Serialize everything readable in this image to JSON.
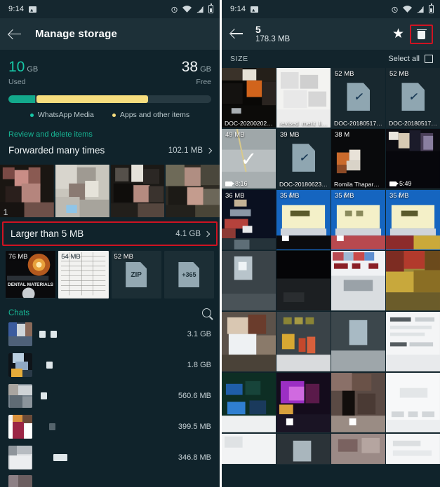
{
  "left": {
    "statusbar": {
      "time": "9:14",
      "icons": [
        "photo-icon",
        "alarm-icon",
        "wifi-icon",
        "signal-icon",
        "battery-icon"
      ]
    },
    "appbar": {
      "back": "back-arrow",
      "title": "Manage storage"
    },
    "storage": {
      "used_value": "10",
      "used_unit": "GB",
      "used_label": "Used",
      "free_value": "38",
      "free_unit": "GB",
      "free_label": "Free",
      "bar": {
        "media_pct": 13,
        "apps_pct": 55,
        "media_color": "#13a98c",
        "apps_color": "#f6dd7e",
        "track_color": "#273a42"
      },
      "legend": [
        {
          "label": "WhatsApp Media",
          "color": "#16c7a6"
        },
        {
          "label": "Apps and other items",
          "color": "#f6dd7e"
        }
      ]
    },
    "review_hint": "Review and delete items",
    "forwarded": {
      "label": "Forwarded many times",
      "size": "102.1 MB"
    },
    "larger": {
      "label": "Larger than 5 MB",
      "size": "4.1 GB",
      "highlight_color": "#cf1322"
    },
    "file_tiles": [
      {
        "size": "76 MB",
        "kind": "image-thumbnail",
        "caption": "DENTAL MATERIALS"
      },
      {
        "size": "54 MB",
        "kind": "spreadsheet-thumbnail",
        "caption": ""
      },
      {
        "size": "52 MB",
        "kind": "zip-file",
        "caption": "ZIP"
      },
      {
        "size": "",
        "kind": "overflow-tile",
        "caption": "+365"
      }
    ],
    "chats": {
      "title": "Chats",
      "search": "search-icon"
    },
    "chat_rows": [
      {
        "size": "3.1 GB"
      },
      {
        "size": "1.8 GB"
      },
      {
        "size": "560.6 MB"
      },
      {
        "size": "399.5 MB"
      },
      {
        "size": "346.8 MB"
      }
    ]
  },
  "right": {
    "statusbar": {
      "time": "9:14",
      "icons": [
        "photo-icon",
        "alarm-icon",
        "wifi-icon",
        "signal-icon",
        "battery-icon"
      ]
    },
    "appbar": {
      "back": "back-arrow",
      "selected_count": "5",
      "selected_size": "178.3 MB",
      "star": "star-icon",
      "delete": "trash-icon",
      "delete_highlight_color": "#cf1322"
    },
    "toolbar": {
      "sort_label": "SIZE",
      "select_all_label": "Select all"
    },
    "grid": [
      {
        "size": "",
        "name": "DOC-20200202…",
        "kind": "photo-thumbnail",
        "selected": false
      },
      {
        "size": "",
        "name": "revised_merit_li…",
        "kind": "document-thumbnail",
        "selected": false
      },
      {
        "size": "52 MB",
        "name": "DOC-20180517…",
        "kind": "signed-document",
        "selected": false
      },
      {
        "size": "52 MB",
        "name": "DOC-20180517…",
        "kind": "signed-document",
        "selected": false
      },
      {
        "size": "49 MB",
        "name": "8:16",
        "kind": "video-thumbnail",
        "selected": true
      },
      {
        "size": "39 MB",
        "name": "DOC-20180623…",
        "kind": "signed-document",
        "selected": false
      },
      {
        "size": "38 M",
        "name": "Romila Thapar…",
        "kind": "document-thumbnail",
        "selected": false
      },
      {
        "size": "",
        "name": "5:49",
        "kind": "video-thumbnail",
        "selected": false
      },
      {
        "size": "36 MB",
        "name": "",
        "kind": "photo-thumbnail",
        "selected": false
      },
      {
        "size": "35 MB",
        "name": "",
        "kind": "blue-certificate",
        "selected": false
      },
      {
        "size": "35 MB",
        "name": "",
        "kind": "blue-certificate",
        "selected": false
      },
      {
        "size": "35 MB",
        "name": "",
        "kind": "blue-certificate",
        "selected": false
      },
      {
        "size": "",
        "name": "",
        "kind": "photo-thumbnail",
        "selected": false
      },
      {
        "size": "",
        "name": "",
        "kind": "photo-thumbnail",
        "selected": false
      },
      {
        "size": "",
        "name": "",
        "kind": "photo-thumbnail",
        "selected": false
      },
      {
        "size": "",
        "name": "",
        "kind": "photo-thumbnail",
        "selected": false
      },
      {
        "size": "",
        "name": "",
        "kind": "photo-thumbnail",
        "selected": false
      },
      {
        "size": "",
        "name": "",
        "kind": "photo-thumbnail",
        "selected": false
      },
      {
        "size": "",
        "name": "",
        "kind": "document-thumbnail",
        "selected": false
      },
      {
        "size": "",
        "name": "",
        "kind": "document-thumbnail",
        "selected": false
      },
      {
        "size": "",
        "name": "",
        "kind": "photo-thumbnail",
        "selected": false
      },
      {
        "size": "",
        "name": "",
        "kind": "document-thumbnail",
        "selected": false
      },
      {
        "size": "",
        "name": "",
        "kind": "photo-thumbnail",
        "selected": false
      },
      {
        "size": "",
        "name": "",
        "kind": "blue-image",
        "selected": false
      },
      {
        "size": "",
        "name": "",
        "kind": "photo-thumbnail",
        "selected": false
      },
      {
        "size": "",
        "name": "",
        "kind": "photo-thumbnail",
        "selected": false
      },
      {
        "size": "",
        "name": "",
        "kind": "photo-thumbnail",
        "selected": false
      },
      {
        "size": "",
        "name": "",
        "kind": "document-thumbnail",
        "selected": false
      }
    ]
  }
}
